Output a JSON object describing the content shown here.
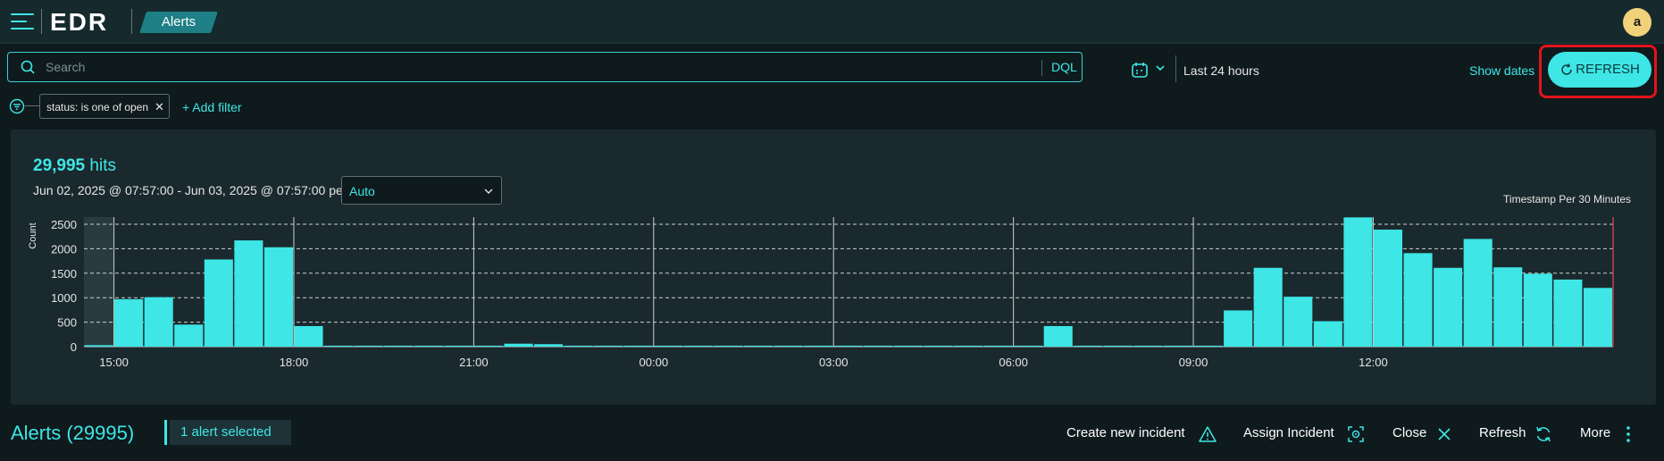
{
  "app": {
    "name": "EDR",
    "breadcrumb": "Alerts"
  },
  "user": {
    "avatar_letter": "a"
  },
  "search": {
    "placeholder": "Search",
    "dql_label": "DQL"
  },
  "time_picker": {
    "label": "Last 24 hours",
    "show_dates": "Show dates"
  },
  "refresh_button": {
    "label": "REFRESH"
  },
  "filters": {
    "chips": [
      "status: is one of open"
    ],
    "add_label": "+ Add filter"
  },
  "histogram": {
    "hits_count": "29,995",
    "hits_label": "hits",
    "range_text": "Jun 02, 2025 @ 07:57:00 - Jun 03, 2025 @ 07:57:00 per",
    "interval_value": "Auto"
  },
  "chart_data": {
    "type": "bar",
    "title": "Timestamp Per 30 Minutes",
    "ylabel": "Count",
    "ylim": [
      0,
      2500
    ],
    "yticks": [
      0,
      500,
      1000,
      1500,
      2000,
      2500
    ],
    "xtick_labels": [
      "15:00",
      "18:00",
      "21:00",
      "00:00",
      "03:00",
      "06:00",
      "09:00",
      "12:00"
    ],
    "grid": "horizontal-dashed",
    "values": [
      30,
      970,
      1010,
      450,
      1780,
      2170,
      2030,
      420,
      20,
      20,
      20,
      20,
      20,
      20,
      60,
      50,
      20,
      20,
      20,
      20,
      20,
      20,
      20,
      20,
      20,
      20,
      20,
      20,
      20,
      20,
      20,
      20,
      420,
      20,
      20,
      20,
      20,
      20,
      740,
      1610,
      1020,
      520,
      2640,
      2390,
      1910,
      1610,
      2200,
      1620,
      1490,
      1370,
      1200
    ],
    "colors": {
      "bar": "#3ee6e6"
    }
  },
  "alerts_bar": {
    "title": "Alerts (29995)",
    "selected_text": "1 alert selected",
    "actions": {
      "create": "Create new incident",
      "assign": "Assign Incident",
      "close": "Close",
      "refresh": "Refresh",
      "more": "More"
    }
  },
  "colors": {
    "accent": "#3ee6e6",
    "background": "#0f1a1d",
    "highlight": "#e0141b"
  }
}
